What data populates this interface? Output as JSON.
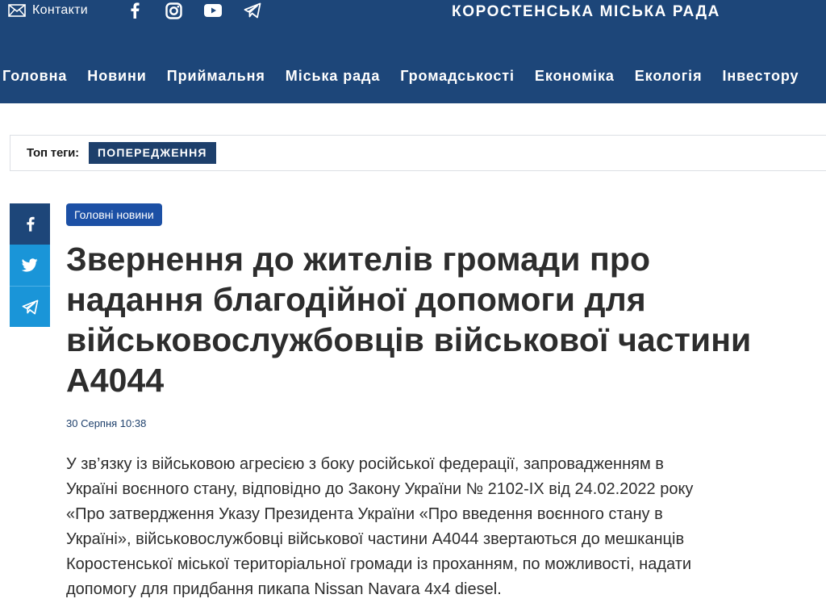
{
  "header": {
    "contact_label": "Контакти",
    "site_title": "КОРОСТЕНСЬКА МІСЬКА РАДА",
    "social": [
      {
        "icon": "facebook-icon"
      },
      {
        "icon": "instagram-icon"
      },
      {
        "icon": "youtube-icon"
      },
      {
        "icon": "telegram-icon"
      }
    ],
    "nav": [
      "Головна",
      "Новини",
      "Приймальня",
      "Міська рада",
      "Громадськості",
      "Економіка",
      "Екологія",
      "Інвестору"
    ]
  },
  "tags": {
    "label": "Топ теги:",
    "items": [
      "ПОПЕРЕДЖЕННЯ"
    ]
  },
  "share": [
    {
      "icon": "facebook-icon"
    },
    {
      "icon": "twitter-icon"
    },
    {
      "icon": "telegram-icon"
    }
  ],
  "article": {
    "category": "Головні новини",
    "title": "Звернення до жителів громади про надання благодійної допомоги для військовослужбовців військової частини А4044",
    "date": "30 Серпня 10:38",
    "body": [
      "У зв’язку із військовою агресією з боку російської федерації, запровадженням в",
      "Україні воєнного стану, відповідно до Закону України № 2102-IX від 24.02.2022 року",
      "«Про затвердження Указу Президента України «Про введення воєнного стану в",
      "Україні», військовослужбовці військової частини А4044 звертаються до мешканців",
      "Коростенської міської територіальної громади із проханням, по можливості,  надати",
      "допомогу для придбання пикапа Nissan Navara 4x4 diesel."
    ]
  },
  "colors": {
    "header_bg": "#1d4679",
    "tag_bg": "#1d3f6b",
    "badge_bg": "#1c50a5",
    "twitter_blue": "#1a95d8"
  }
}
